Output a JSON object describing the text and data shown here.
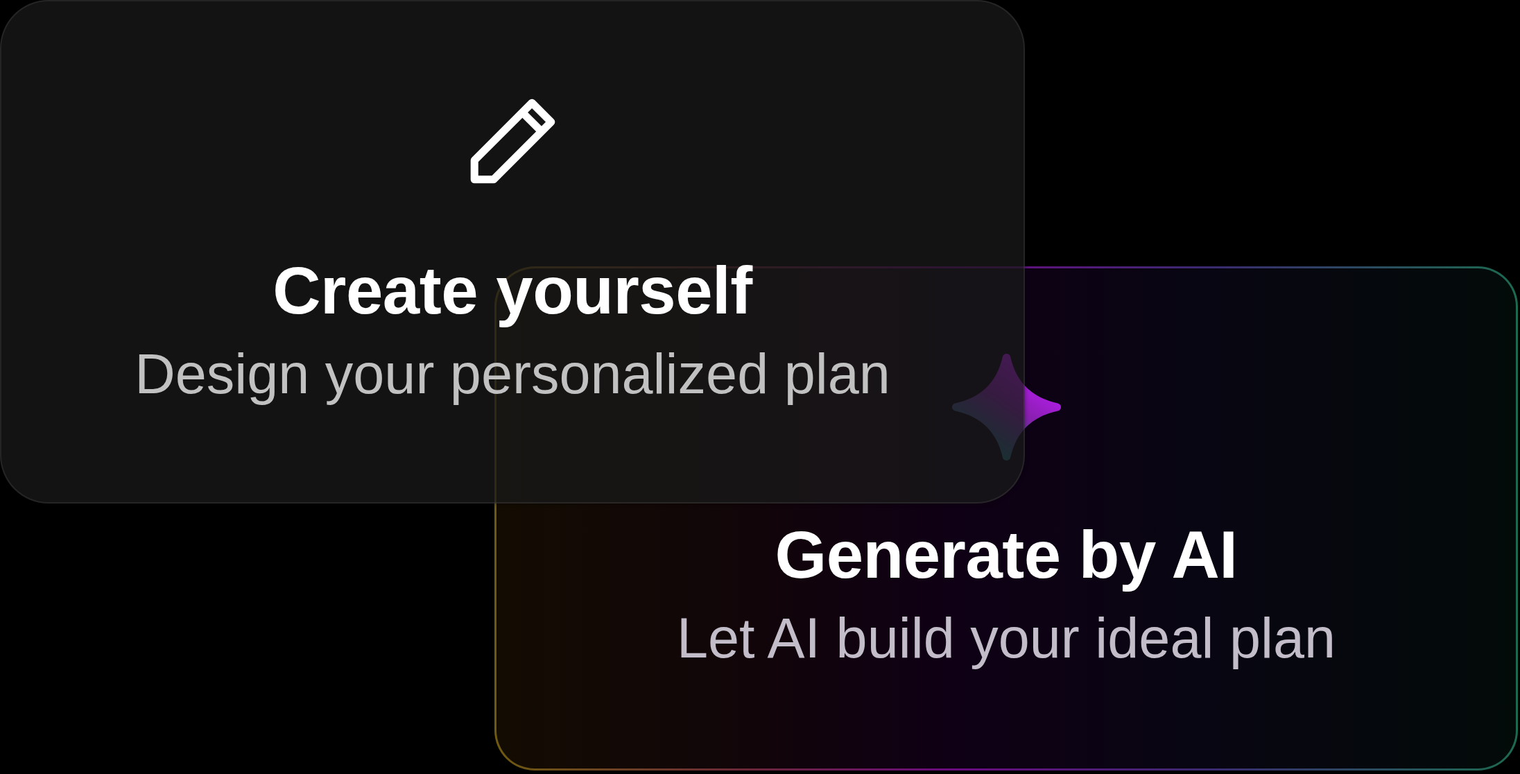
{
  "cards": [
    {
      "kind": "manual",
      "title": "Create yourself",
      "subtitle": "Design your personalized plan"
    },
    {
      "kind": "ai",
      "title": "Generate by AI",
      "subtitle": "Let AI build your ideal plan"
    }
  ]
}
